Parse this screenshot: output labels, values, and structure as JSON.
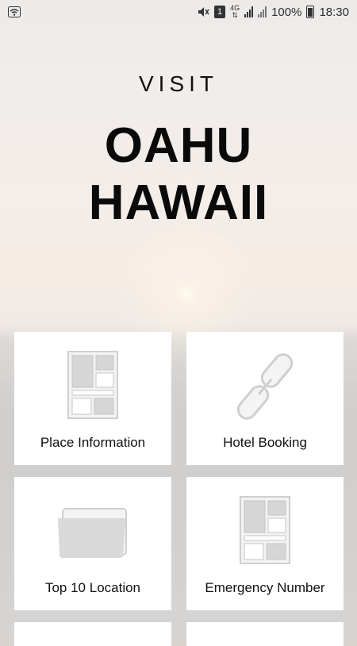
{
  "status_bar": {
    "battery_percent": "100%",
    "time": "18:30",
    "sim_slot": "1",
    "network": "4G"
  },
  "header": {
    "visit": "VISIT",
    "title_line1": "OAHU",
    "title_line2": "HAWAII"
  },
  "tiles": [
    {
      "label": "Place Information",
      "icon": "layout-icon"
    },
    {
      "label": "Hotel Booking",
      "icon": "chain-link-icon"
    },
    {
      "label": "Top 10 Location",
      "icon": "folder-icon"
    },
    {
      "label": "Emergency Number",
      "icon": "layout-icon"
    }
  ]
}
